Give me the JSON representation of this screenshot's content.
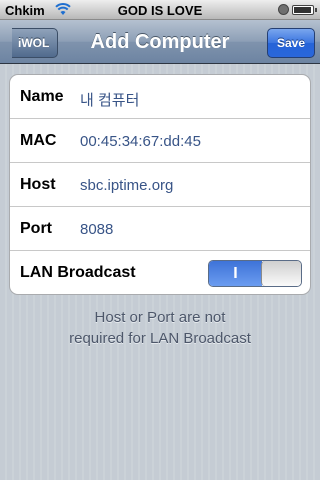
{
  "status_bar": {
    "carrier": "Chkim",
    "center_text": "GOD IS LOVE",
    "wifi_icon": "wifi-icon",
    "lock_icon": "orientation-lock-icon",
    "battery_icon": "battery-icon"
  },
  "nav": {
    "back_label": "iWOL",
    "title": "Add Computer",
    "save_label": "Save"
  },
  "form": {
    "rows": [
      {
        "label": "Name",
        "value": "내 컴퓨터"
      },
      {
        "label": "MAC",
        "value": "00:45:34:67:dd:45"
      },
      {
        "label": "Host",
        "value": "sbc.iptime.org"
      },
      {
        "label": "Port",
        "value": "8088"
      }
    ],
    "lan_broadcast": {
      "label": "LAN Broadcast",
      "on_text": "I",
      "state": true
    }
  },
  "footer_note": {
    "line1": "Host or Port are not",
    "line2": "required for LAN Broadcast"
  },
  "colors": {
    "nav_accent": "#6d84a2",
    "save_button": "#2a67db",
    "value_text": "#385487",
    "switch_on": "#3e73d8"
  }
}
